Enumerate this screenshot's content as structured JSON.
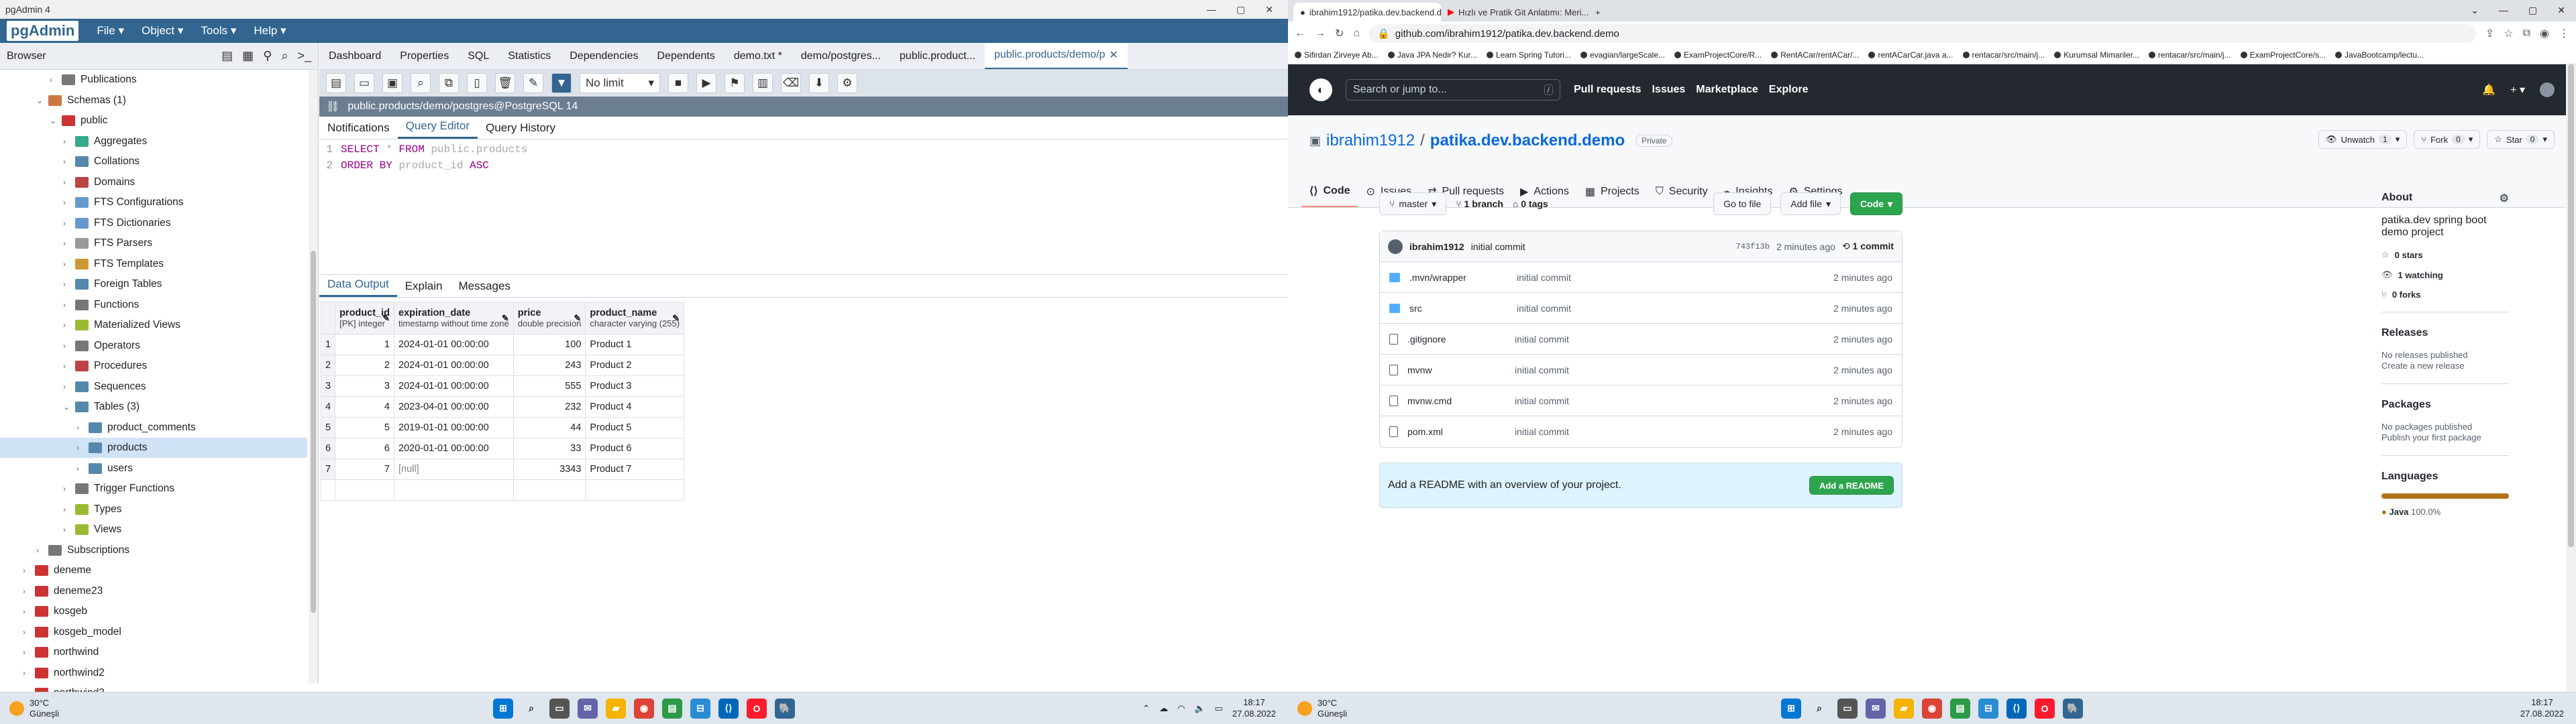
{
  "pgadmin": {
    "title": "pgAdmin 4",
    "logo": "pgAdmin",
    "menu": [
      "File",
      "Object",
      "Tools",
      "Help"
    ],
    "browser_label": "Browser",
    "tree": [
      {
        "label": "Publications",
        "depth": 3,
        "arrow": "›",
        "icon": "publications-icon",
        "color": "#777"
      },
      {
        "label": "Schemas (1)",
        "depth": 2,
        "arrow": "⌄",
        "icon": "schemas-icon",
        "color": "#c74"
      },
      {
        "label": "public",
        "depth": 3,
        "arrow": "⌄",
        "icon": "schema-public-icon",
        "color": "#c33"
      },
      {
        "label": "Aggregates",
        "depth": 4,
        "arrow": "›",
        "icon": "aggregates-icon",
        "color": "#3a8"
      },
      {
        "label": "Collations",
        "depth": 4,
        "arrow": "›",
        "icon": "collations-icon",
        "color": "#58a"
      },
      {
        "label": "Domains",
        "depth": 4,
        "arrow": "›",
        "icon": "domains-icon",
        "color": "#b44"
      },
      {
        "label": "FTS Configurations",
        "depth": 4,
        "arrow": "›",
        "icon": "fts-config-icon",
        "color": "#69c"
      },
      {
        "label": "FTS Dictionaries",
        "depth": 4,
        "arrow": "›",
        "icon": "fts-dict-icon",
        "color": "#69c"
      },
      {
        "label": "FTS Parsers",
        "depth": 4,
        "arrow": "›",
        "icon": "fts-parsers-icon",
        "color": "#999"
      },
      {
        "label": "FTS Templates",
        "depth": 4,
        "arrow": "›",
        "icon": "fts-templates-icon",
        "color": "#c93"
      },
      {
        "label": "Foreign Tables",
        "depth": 4,
        "arrow": "›",
        "icon": "foreign-tables-icon",
        "color": "#58a"
      },
      {
        "label": "Functions",
        "depth": 4,
        "arrow": "›",
        "icon": "functions-icon",
        "color": "#777"
      },
      {
        "label": "Materialized Views",
        "depth": 4,
        "arrow": "›",
        "icon": "mat-views-icon",
        "color": "#9b3"
      },
      {
        "label": "Operators",
        "depth": 4,
        "arrow": "›",
        "icon": "operators-icon",
        "color": "#777"
      },
      {
        "label": "Procedures",
        "depth": 4,
        "arrow": "›",
        "icon": "procedures-icon",
        "color": "#b44"
      },
      {
        "label": "Sequences",
        "depth": 4,
        "arrow": "›",
        "icon": "sequences-icon",
        "color": "#58a"
      },
      {
        "label": "Tables (3)",
        "depth": 4,
        "arrow": "⌄",
        "icon": "tables-icon",
        "color": "#58a"
      },
      {
        "label": "product_comments",
        "depth": 5,
        "arrow": "›",
        "icon": "table-icon",
        "color": "#58a"
      },
      {
        "label": "products",
        "depth": 5,
        "arrow": "›",
        "icon": "table-icon",
        "color": "#58a",
        "selected": true
      },
      {
        "label": "users",
        "depth": 5,
        "arrow": "›",
        "icon": "table-icon",
        "color": "#58a"
      },
      {
        "label": "Trigger Functions",
        "depth": 4,
        "arrow": "›",
        "icon": "trigger-functions-icon",
        "color": "#777"
      },
      {
        "label": "Types",
        "depth": 4,
        "arrow": "›",
        "icon": "types-icon",
        "color": "#9b3"
      },
      {
        "label": "Views",
        "depth": 4,
        "arrow": "›",
        "icon": "views-icon",
        "color": "#9b3"
      },
      {
        "label": "Subscriptions",
        "depth": 2,
        "arrow": "›",
        "icon": "subscriptions-icon",
        "color": "#777"
      },
      {
        "label": "deneme",
        "depth": 1,
        "arrow": "›",
        "icon": "database-icon",
        "color": "#c33"
      },
      {
        "label": "deneme23",
        "depth": 1,
        "arrow": "›",
        "icon": "database-icon",
        "color": "#c33"
      },
      {
        "label": "kosgeb",
        "depth": 1,
        "arrow": "›",
        "icon": "database-icon",
        "color": "#c33"
      },
      {
        "label": "kosgeb_model",
        "depth": 1,
        "arrow": "›",
        "icon": "database-icon",
        "color": "#c33"
      },
      {
        "label": "northwind",
        "depth": 1,
        "arrow": "›",
        "icon": "database-icon",
        "color": "#c33"
      },
      {
        "label": "northwind2",
        "depth": 1,
        "arrow": "›",
        "icon": "database-icon",
        "color": "#c33"
      },
      {
        "label": "northwind3",
        "depth": 1,
        "arrow": "›",
        "icon": "database-icon",
        "color": "#c33"
      }
    ],
    "tabs": [
      "Dashboard",
      "Properties",
      "SQL",
      "Statistics",
      "Dependencies",
      "Dependents",
      "demo.txt *",
      "demo/postgres...",
      "public.product...",
      "public.products/demo/p"
    ],
    "active_tab_index": 9,
    "limit": "No limit",
    "connection": "public.products/demo/postgres@PostgreSQL 14",
    "editor_tabs": [
      "Notifications",
      "Query Editor",
      "Query History"
    ],
    "editor_active": 1,
    "sql_lines": [
      {
        "n": "1",
        "kw1": "SELECT",
        "mid": " * ",
        "kw2": "FROM",
        "rest": " public.products"
      },
      {
        "n": "2",
        "kw1": "ORDER BY",
        "mid": " product_id ",
        "kw2": "ASC",
        "rest": ""
      }
    ],
    "result_tabs": [
      "Data Output",
      "Explain",
      "Messages"
    ],
    "columns": [
      {
        "name": "product_id",
        "type": "[PK] integer"
      },
      {
        "name": "expiration_date",
        "type": "timestamp without time zone"
      },
      {
        "name": "price",
        "type": "double precision"
      },
      {
        "name": "product_name",
        "type": "character varying (255)"
      }
    ],
    "rows": [
      [
        "1",
        "1",
        "2024-01-01 00:00:00",
        "100",
        "Product 1"
      ],
      [
        "2",
        "2",
        "2024-01-01 00:00:00",
        "243",
        "Product 2"
      ],
      [
        "3",
        "3",
        "2024-01-01 00:00:00",
        "555",
        "Product 3"
      ],
      [
        "4",
        "4",
        "2023-04-01 00:00:00",
        "232",
        "Product 4"
      ],
      [
        "5",
        "5",
        "2019-01-01 00:00:00",
        "44",
        "Product 5"
      ],
      [
        "6",
        "6",
        "2020-01-01 00:00:00",
        "33",
        "Product 6"
      ],
      [
        "7",
        "7",
        "[null]",
        "3343",
        "Product 7"
      ]
    ]
  },
  "taskbar_left": {
    "temp": "30°C",
    "cond": "Güneşli",
    "time": "18:17",
    "date": "27.08.2022"
  },
  "taskbar_right": {
    "temp": "30°C",
    "cond": "Güneşli",
    "time": "18:17",
    "date": "27.08.2022"
  },
  "chrome": {
    "tabs": [
      "ibrahim1912/patika.dev.backend.demo",
      "Hızlı ve Pratik Git Anlatımı: Meri..."
    ],
    "url": "github.com/ibrahim1912/patika.dev.backend.demo",
    "bookmarks": [
      "Sifirdan Zirveye Ab...",
      "Java JPA Nedir? Kur...",
      "Learn Spring Tutori...",
      "evagian/largeScale...",
      "ExamProjectCore/R...",
      "RentACar/rentACar/...",
      "rentACarCar.java a...",
      "rentacar/src/main/j...",
      "Kurumsal Mimariler...",
      "rentacar/src/main/j...",
      "ExamProjectCore/s...",
      "JavaBootcamp/lectu..."
    ]
  },
  "github": {
    "search_placeholder": "Search or jump to...",
    "search_key": "/",
    "nav": [
      "Pull requests",
      "Issues",
      "Marketplace",
      "Explore"
    ],
    "owner": "ibrahim1912",
    "sep": "/",
    "repo": "patika.dev.backend.demo",
    "visibility": "Private",
    "unwatch": "Unwatch",
    "watch_count": "1",
    "fork": "Fork",
    "fork_count": "0",
    "star": "Star",
    "star_count": "0",
    "tabs": [
      "Code",
      "Issues",
      "Pull requests",
      "Actions",
      "Projects",
      "Security",
      "Insights",
      "Settings"
    ],
    "branch": "master",
    "branches": "1 branch",
    "tags": "0 tags",
    "goto": "Go to file",
    "addfile": "Add file",
    "code": "Code",
    "commit_user": "ibrahim1912",
    "commit_msg": "initial commit",
    "commit_hash": "743f13b",
    "commit_age": "2 minutes ago",
    "commit_count": "1 commit",
    "files": [
      {
        "name": ".mvn/wrapper",
        "type": "dir",
        "msg": "initial commit",
        "age": "2 minutes ago"
      },
      {
        "name": "src",
        "type": "dir",
        "msg": "initial commit",
        "age": "2 minutes ago"
      },
      {
        "name": ".gitignore",
        "type": "file",
        "msg": "initial commit",
        "age": "2 minutes ago"
      },
      {
        "name": "mvnw",
        "type": "file",
        "msg": "initial commit",
        "age": "2 minutes ago"
      },
      {
        "name": "mvnw.cmd",
        "type": "file",
        "msg": "initial commit",
        "age": "2 minutes ago"
      },
      {
        "name": "pom.xml",
        "type": "file",
        "msg": "initial commit",
        "age": "2 minutes ago"
      }
    ],
    "readme_text": "Add a README with an overview of your project.",
    "readme_btn": "Add a README",
    "about": {
      "title": "About",
      "desc": "patika.dev spring boot demo project",
      "stars": "0 stars",
      "watching": "1 watching",
      "forks": "0 forks"
    },
    "releases": {
      "title": "Releases",
      "none": "No releases published",
      "link": "Create a new release"
    },
    "packages": {
      "title": "Packages",
      "none": "No packages published",
      "link": "Publish your first package"
    },
    "languages": {
      "title": "Languages",
      "lang": "Java",
      "pct": "100.0%",
      "color": "#b07219"
    }
  }
}
